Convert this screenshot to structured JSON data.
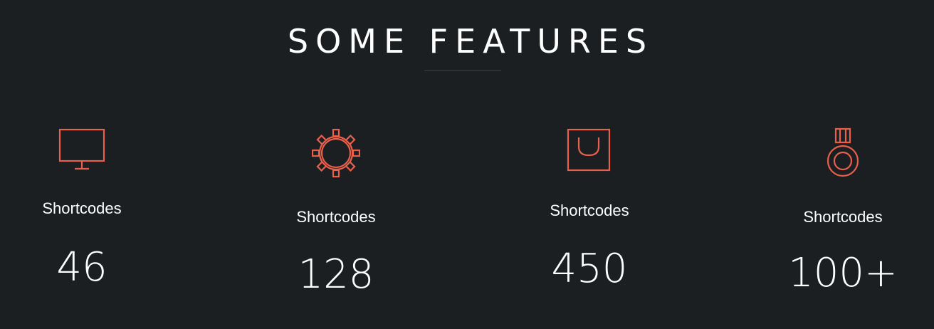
{
  "section": {
    "title": "SOME FEATURES"
  },
  "colors": {
    "background": "#1b1f22",
    "accent": "#e8604c",
    "text": "#ffffff",
    "underline": "#3c4248"
  },
  "features": [
    {
      "icon": "monitor-icon",
      "label": "Shortcodes",
      "count": "46"
    },
    {
      "icon": "gear-icon",
      "label": "Shortcodes",
      "count": "128"
    },
    {
      "icon": "shopping-bag-icon",
      "label": "Shortcodes",
      "count": "450"
    },
    {
      "icon": "medal-icon",
      "label": "Shortcodes",
      "count": "100+"
    }
  ]
}
